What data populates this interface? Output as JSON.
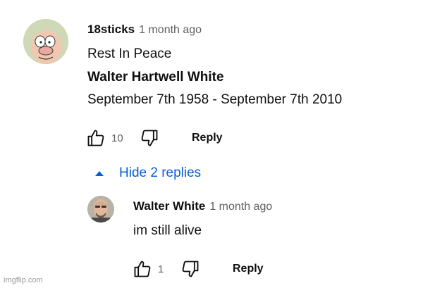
{
  "comment": {
    "author": "18sticks",
    "time": "1 month ago",
    "lines": [
      "Rest In Peace",
      "Walter Hartwell White",
      "September 7th 1958 - September 7th 2010"
    ],
    "likes": "10",
    "reply_label": "Reply",
    "avatar_icon": "cartoon-face-avatar"
  },
  "replies_toggle": {
    "label": "Hide 2 replies",
    "icon": "caret-up-icon",
    "color": "#065fd4"
  },
  "reply": {
    "author": "Walter White",
    "time": "1 month ago",
    "text": "im still alive",
    "likes": "1",
    "reply_label": "Reply",
    "avatar_icon": "bald-man-avatar"
  },
  "watermark": "imgflip.com"
}
